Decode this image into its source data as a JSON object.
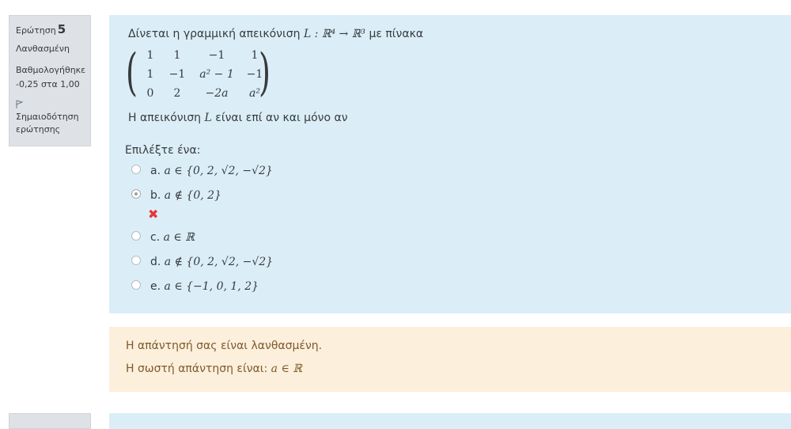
{
  "question_info": {
    "label": "Ερώτηση",
    "number": "5",
    "state": "Λανθασμένη",
    "grade": "Βαθμολογήθηκε -0,25 στα 1,00",
    "flag_label": "Σημαιοδότηση ερώτησης"
  },
  "question": {
    "text_before": "Δίνεται η γραμμική απεικόνιση",
    "mapping": "L : ℝ⁴ → ℝ³",
    "text_after": "με πίνακα",
    "matrix": [
      [
        "1",
        "1",
        "−1",
        "1"
      ],
      [
        "1",
        "−1",
        "a² − 1",
        "−1"
      ],
      [
        "0",
        "2",
        "−2a",
        "a²"
      ]
    ],
    "statement_pre": "Η απεικόνιση",
    "statement_var": "L",
    "statement_post": "είναι επί αν και μόνο αν",
    "prompt": "Επιλέξτε ένα:"
  },
  "answers": [
    {
      "prefix": "a.",
      "math": "a ∈ {0, 2, √2, −√2}",
      "selected": false
    },
    {
      "prefix": "b.",
      "math": "a ∉ {0, 2}",
      "selected": true,
      "incorrect": true
    },
    {
      "prefix": "c.",
      "math": "a ∈ ℝ",
      "selected": false
    },
    {
      "prefix": "d.",
      "math": "a ∉ {0, 2, √2, −√2}",
      "selected": false
    },
    {
      "prefix": "e.",
      "math": "a ∈ {−1, 0, 1, 2}",
      "selected": false
    }
  ],
  "feedback": {
    "status": "Η απάντησή σας είναι λανθασμένη.",
    "right_answer_label": "Η σωστή απάντηση είναι:",
    "right_answer_math": "a ∈ ℝ"
  },
  "colors": {
    "info_bg": "#dee2e6",
    "question_bg": "#dbeef8",
    "feedback_bg": "#fcefdc",
    "incorrect": "#e53935"
  }
}
